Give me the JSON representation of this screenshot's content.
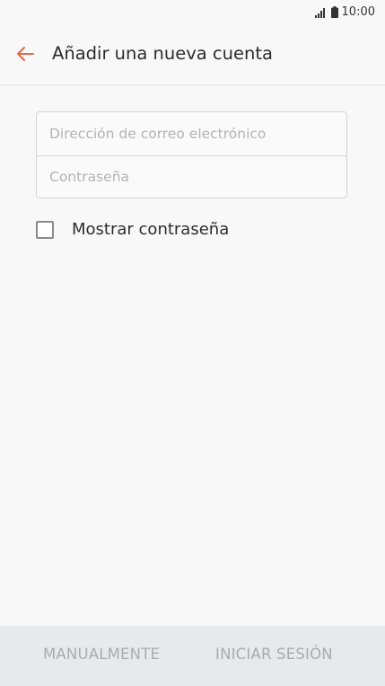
{
  "status_bar": {
    "time": "10:00"
  },
  "header": {
    "title": "Añadir una nueva cuenta",
    "back_icon": "arrow-left-icon",
    "accent_color": "#e06a4a"
  },
  "form": {
    "email_placeholder": "Dirección de correo electrónico",
    "email_value": "",
    "password_placeholder": "Contraseña",
    "password_value": ""
  },
  "show_password": {
    "label": "Mostrar contraseña",
    "checked": false
  },
  "bottom_bar": {
    "manual_label": "MANUALMENTE",
    "login_label": "INICIAR SESIÓN"
  }
}
